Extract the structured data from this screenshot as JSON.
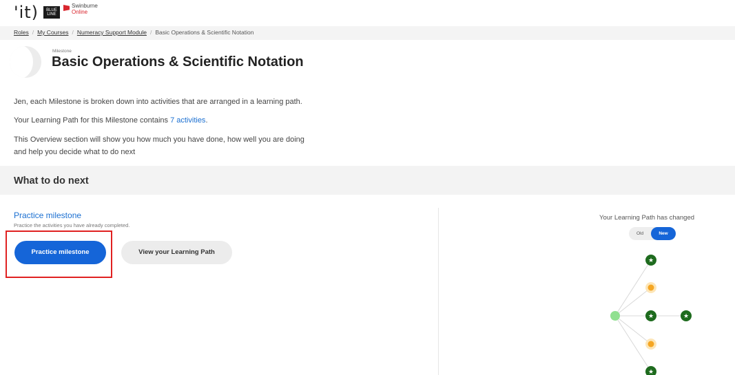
{
  "header": {
    "logo_text": "'it)",
    "logo_box_text": "BLUE LINE",
    "brand_name": "Swinburne",
    "brand_sub": "Online"
  },
  "breadcrumb": {
    "items": [
      "Roles",
      "My Courses",
      "Numeracy Support Module"
    ],
    "current": "Basic Operations & Scientific Notation"
  },
  "milestone": {
    "eyebrow": "Milestone",
    "title": "Basic Operations & Scientific Notation"
  },
  "intro": {
    "line1": "Jen, each Milestone is broken down into activities that are arranged in a learning path.",
    "line2_prefix": "Your Learning Path for this Milestone contains ",
    "line2_link": "7 activities",
    "line2_suffix": ".",
    "line3": "This Overview section will show you how much you have done, how well you are doing",
    "line4": "and help you decide what to do next"
  },
  "next": {
    "heading": "What to do next",
    "practice_link": "Practice milestone",
    "practice_desc": "Practice the activities you have already completed.",
    "practice_button": "Practice milestone",
    "path_button": "View your Learning Path"
  },
  "learning_path": {
    "changed_text": "Your Learning Path has changed",
    "toggle_old": "Old",
    "toggle_new": "New",
    "node_colors": {
      "start": "#90e090",
      "completed": "#1e6b1e",
      "pending": "#f5a623",
      "pending_halo": "#fde6b8"
    }
  }
}
